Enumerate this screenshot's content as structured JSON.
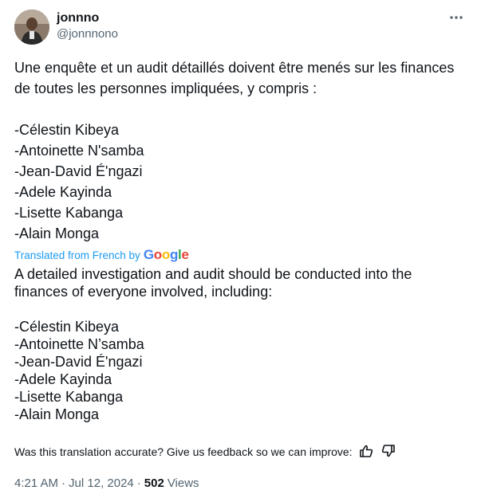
{
  "author": {
    "display_name": "jonnno",
    "handle": "@jonnnono"
  },
  "tweet": {
    "original_text": "Une enquête et un audit détaillés doivent être menés sur les finances de toutes les personnes impliquées, y compris :\n\n-Célestin Kibeya\n-Antoinette N'samba\n-Jean-David É'ngazi\n-Adele Kayinda\n-Lisette Kabanga\n-Alain Monga",
    "translated_label": "Translated from French by",
    "translation_provider": "Google",
    "translated_text": "A detailed investigation and audit should be conducted into the finances of everyone involved, including:\n\n-Célestin Kibeya\n-Antoinette N’samba\n-Jean-David É'ngazi\n-Adele Kayinda\n-Lisette Kabanga\n-Alain Monga",
    "feedback_prompt": "Was this translation accurate? Give us feedback so we can improve:"
  },
  "meta": {
    "time": "4:21 AM",
    "separator": "·",
    "date": "Jul 12, 2024",
    "views_count": "502",
    "views_label": "Views"
  },
  "colors": {
    "link_blue": "#1d9bf0",
    "secondary_text": "#536471",
    "primary_text": "#0f1419"
  },
  "icons": {
    "more": "more-icon",
    "thumbs_up": "thumbs-up-icon",
    "thumbs_down": "thumbs-down-icon"
  }
}
